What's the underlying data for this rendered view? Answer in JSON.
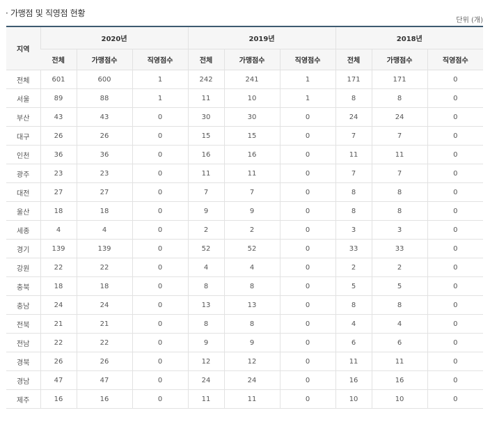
{
  "page": {
    "title": "· 가맹점 및 직영점 현황",
    "unit": "단위 (개)"
  },
  "table": {
    "region_header": "지역",
    "years": [
      "2020년",
      "2019년",
      "2018년"
    ],
    "sub_headers": [
      "전체",
      "가맹점수",
      "직영점수"
    ],
    "rows": [
      {
        "region": "전체",
        "y2020": [
          "601",
          "600",
          "1"
        ],
        "y2019": [
          "242",
          "241",
          "1"
        ],
        "y2018": [
          "171",
          "171",
          "0"
        ]
      },
      {
        "region": "서울",
        "y2020": [
          "89",
          "88",
          "1"
        ],
        "y2019": [
          "11",
          "10",
          "1"
        ],
        "y2018": [
          "8",
          "8",
          "0"
        ]
      },
      {
        "region": "부산",
        "y2020": [
          "43",
          "43",
          "0"
        ],
        "y2019": [
          "30",
          "30",
          "0"
        ],
        "y2018": [
          "24",
          "24",
          "0"
        ]
      },
      {
        "region": "대구",
        "y2020": [
          "26",
          "26",
          "0"
        ],
        "y2019": [
          "15",
          "15",
          "0"
        ],
        "y2018": [
          "7",
          "7",
          "0"
        ]
      },
      {
        "region": "인천",
        "y2020": [
          "36",
          "36",
          "0"
        ],
        "y2019": [
          "16",
          "16",
          "0"
        ],
        "y2018": [
          "11",
          "11",
          "0"
        ]
      },
      {
        "region": "광주",
        "y2020": [
          "23",
          "23",
          "0"
        ],
        "y2019": [
          "11",
          "11",
          "0"
        ],
        "y2018": [
          "7",
          "7",
          "0"
        ]
      },
      {
        "region": "대전",
        "y2020": [
          "27",
          "27",
          "0"
        ],
        "y2019": [
          "7",
          "7",
          "0"
        ],
        "y2018": [
          "8",
          "8",
          "0"
        ]
      },
      {
        "region": "울산",
        "y2020": [
          "18",
          "18",
          "0"
        ],
        "y2019": [
          "9",
          "9",
          "0"
        ],
        "y2018": [
          "8",
          "8",
          "0"
        ]
      },
      {
        "region": "세종",
        "y2020": [
          "4",
          "4",
          "0"
        ],
        "y2019": [
          "2",
          "2",
          "0"
        ],
        "y2018": [
          "3",
          "3",
          "0"
        ]
      },
      {
        "region": "경기",
        "y2020": [
          "139",
          "139",
          "0"
        ],
        "y2019": [
          "52",
          "52",
          "0"
        ],
        "y2018": [
          "33",
          "33",
          "0"
        ]
      },
      {
        "region": "강원",
        "y2020": [
          "22",
          "22",
          "0"
        ],
        "y2019": [
          "4",
          "4",
          "0"
        ],
        "y2018": [
          "2",
          "2",
          "0"
        ]
      },
      {
        "region": "충북",
        "y2020": [
          "18",
          "18",
          "0"
        ],
        "y2019": [
          "8",
          "8",
          "0"
        ],
        "y2018": [
          "5",
          "5",
          "0"
        ]
      },
      {
        "region": "충남",
        "y2020": [
          "24",
          "24",
          "0"
        ],
        "y2019": [
          "13",
          "13",
          "0"
        ],
        "y2018": [
          "8",
          "8",
          "0"
        ]
      },
      {
        "region": "전북",
        "y2020": [
          "21",
          "21",
          "0"
        ],
        "y2019": [
          "8",
          "8",
          "0"
        ],
        "y2018": [
          "4",
          "4",
          "0"
        ]
      },
      {
        "region": "전남",
        "y2020": [
          "22",
          "22",
          "0"
        ],
        "y2019": [
          "9",
          "9",
          "0"
        ],
        "y2018": [
          "6",
          "6",
          "0"
        ]
      },
      {
        "region": "경북",
        "y2020": [
          "26",
          "26",
          "0"
        ],
        "y2019": [
          "12",
          "12",
          "0"
        ],
        "y2018": [
          "11",
          "11",
          "0"
        ]
      },
      {
        "region": "경남",
        "y2020": [
          "47",
          "47",
          "0"
        ],
        "y2019": [
          "24",
          "24",
          "0"
        ],
        "y2018": [
          "16",
          "16",
          "0"
        ]
      },
      {
        "region": "제주",
        "y2020": [
          "16",
          "16",
          "0"
        ],
        "y2019": [
          "11",
          "11",
          "0"
        ],
        "y2018": [
          "10",
          "10",
          "0"
        ]
      }
    ]
  }
}
